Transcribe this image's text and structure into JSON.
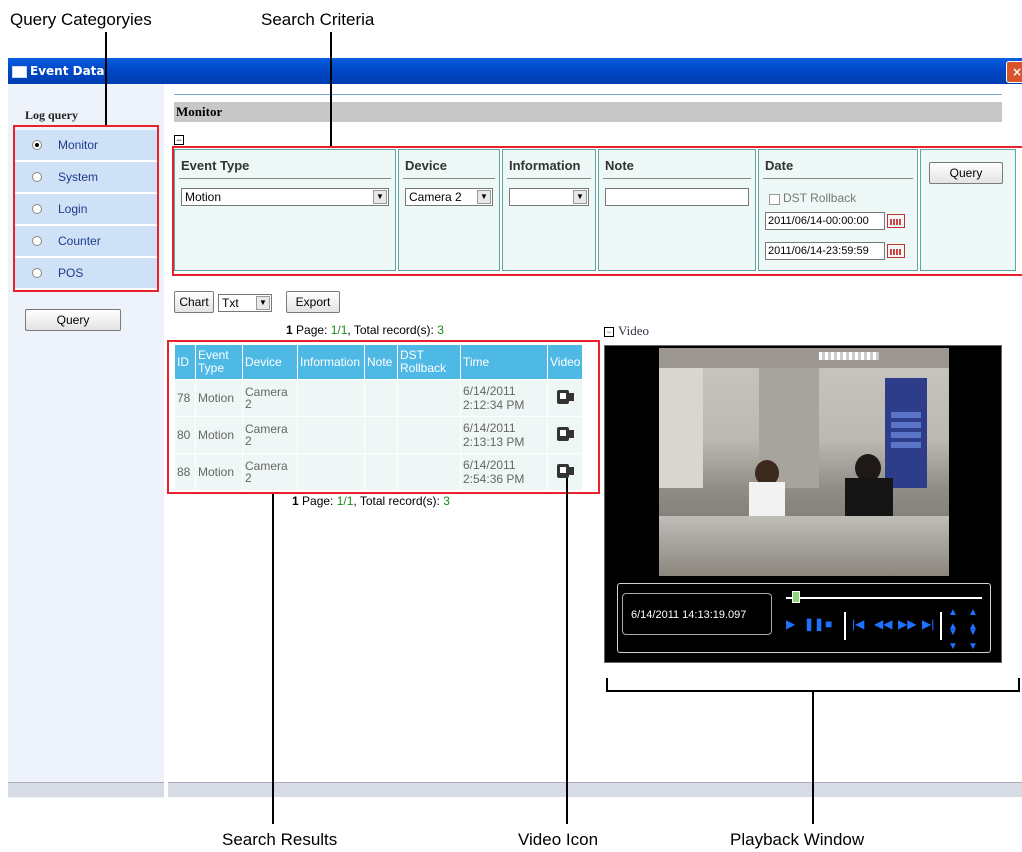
{
  "callouts": {
    "query_categories": "Query Categoryies",
    "search_criteria": "Search Criteria",
    "search_results": "Search Results",
    "video_icon": "Video Icon",
    "playback_window": "Playback Window"
  },
  "window": {
    "title": "Event Data",
    "close_glyph": "×"
  },
  "sidebar": {
    "title": "Log query",
    "items": [
      {
        "label": "Monitor",
        "selected": true
      },
      {
        "label": "System",
        "selected": false
      },
      {
        "label": "Login",
        "selected": false
      },
      {
        "label": "Counter",
        "selected": false
      },
      {
        "label": "POS",
        "selected": false
      }
    ],
    "query_button": "Query"
  },
  "main": {
    "section_title": "Monitor",
    "collapse_glyph": "−",
    "criteria": {
      "event_type": {
        "label": "Event Type",
        "value": "Motion"
      },
      "device": {
        "label": "Device",
        "value": "Camera 2"
      },
      "information": {
        "label": "Information",
        "value": ""
      },
      "note": {
        "label": "Note",
        "value": ""
      },
      "date": {
        "label": "Date",
        "dst_label": "DST Rollback",
        "start": "2011/06/14-00:00:00",
        "end": "2011/06/14-23:59:59"
      },
      "query_button": "Query"
    },
    "toolbar": {
      "chart_button": "Chart",
      "format_value": "Txt",
      "export_button": "Export"
    },
    "paging": {
      "page_num": "1",
      "page_word": " Page: ",
      "page_link": "1/1",
      "total_label": ", Total record(s): ",
      "total_count": "3"
    },
    "results": {
      "headers": [
        "ID",
        "Event Type",
        "Device",
        "Information",
        "Note",
        "DST Rollback",
        "Time",
        "Video"
      ],
      "rows": [
        {
          "id": "78",
          "event_type": "Motion",
          "device": "Camera 2",
          "information": "",
          "note": "",
          "dst": "",
          "time": "6/14/2011 2:12:34 PM"
        },
        {
          "id": "80",
          "event_type": "Motion",
          "device": "Camera 2",
          "information": "",
          "note": "",
          "dst": "",
          "time": "6/14/2011 2:13:13 PM"
        },
        {
          "id": "88",
          "event_type": "Motion",
          "device": "Camera 2",
          "information": "",
          "note": "",
          "dst": "",
          "time": "6/14/2011 2:54:36 PM"
        }
      ]
    },
    "video": {
      "label": "Video",
      "timestamp": "6/14/2011 14:13:19.097",
      "progress": 0.03
    }
  },
  "colors": {
    "annotation_red": "#e8212a",
    "header_blue": "#4fb9e6",
    "title_blue": "#0a5fe0",
    "control_blue": "#1e72ff"
  }
}
